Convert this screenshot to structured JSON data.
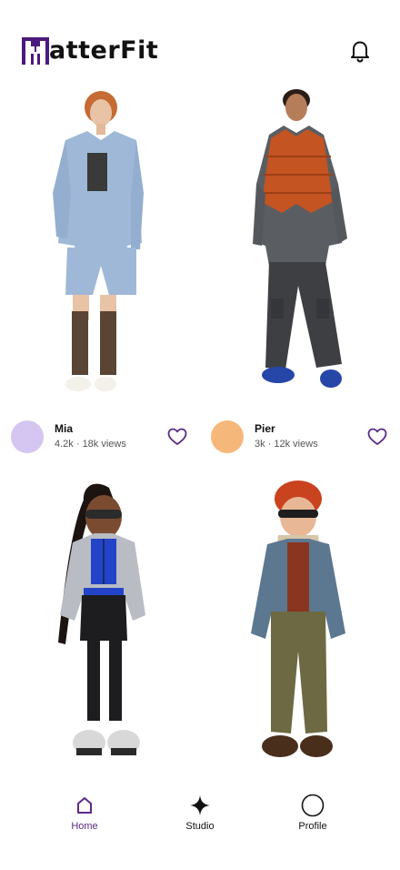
{
  "app": {
    "logo_text": "atterFit",
    "brand_color": "#4b1a7e"
  },
  "header": {
    "notification_icon": "bell-icon"
  },
  "feed": {
    "posts": [
      {
        "name": "Mia",
        "stats": "4.2k · 18k views",
        "avatar_color": "#d4c6f0",
        "icon": "heart-icon"
      },
      {
        "name": "Pier",
        "stats": "3k · 12k views",
        "avatar_color": "#f6b77a",
        "icon": "heart-icon"
      },
      {
        "name": "",
        "stats": ""
      },
      {
        "name": "",
        "stats": ""
      }
    ]
  },
  "nav": {
    "items": [
      {
        "label": "Home",
        "icon": "home-icon",
        "active": true
      },
      {
        "label": "Studio",
        "icon": "sparkle-icon",
        "active": false
      },
      {
        "label": "Profile",
        "icon": "profile-circle-icon",
        "active": false
      }
    ],
    "active_color": "#5a2a86"
  }
}
